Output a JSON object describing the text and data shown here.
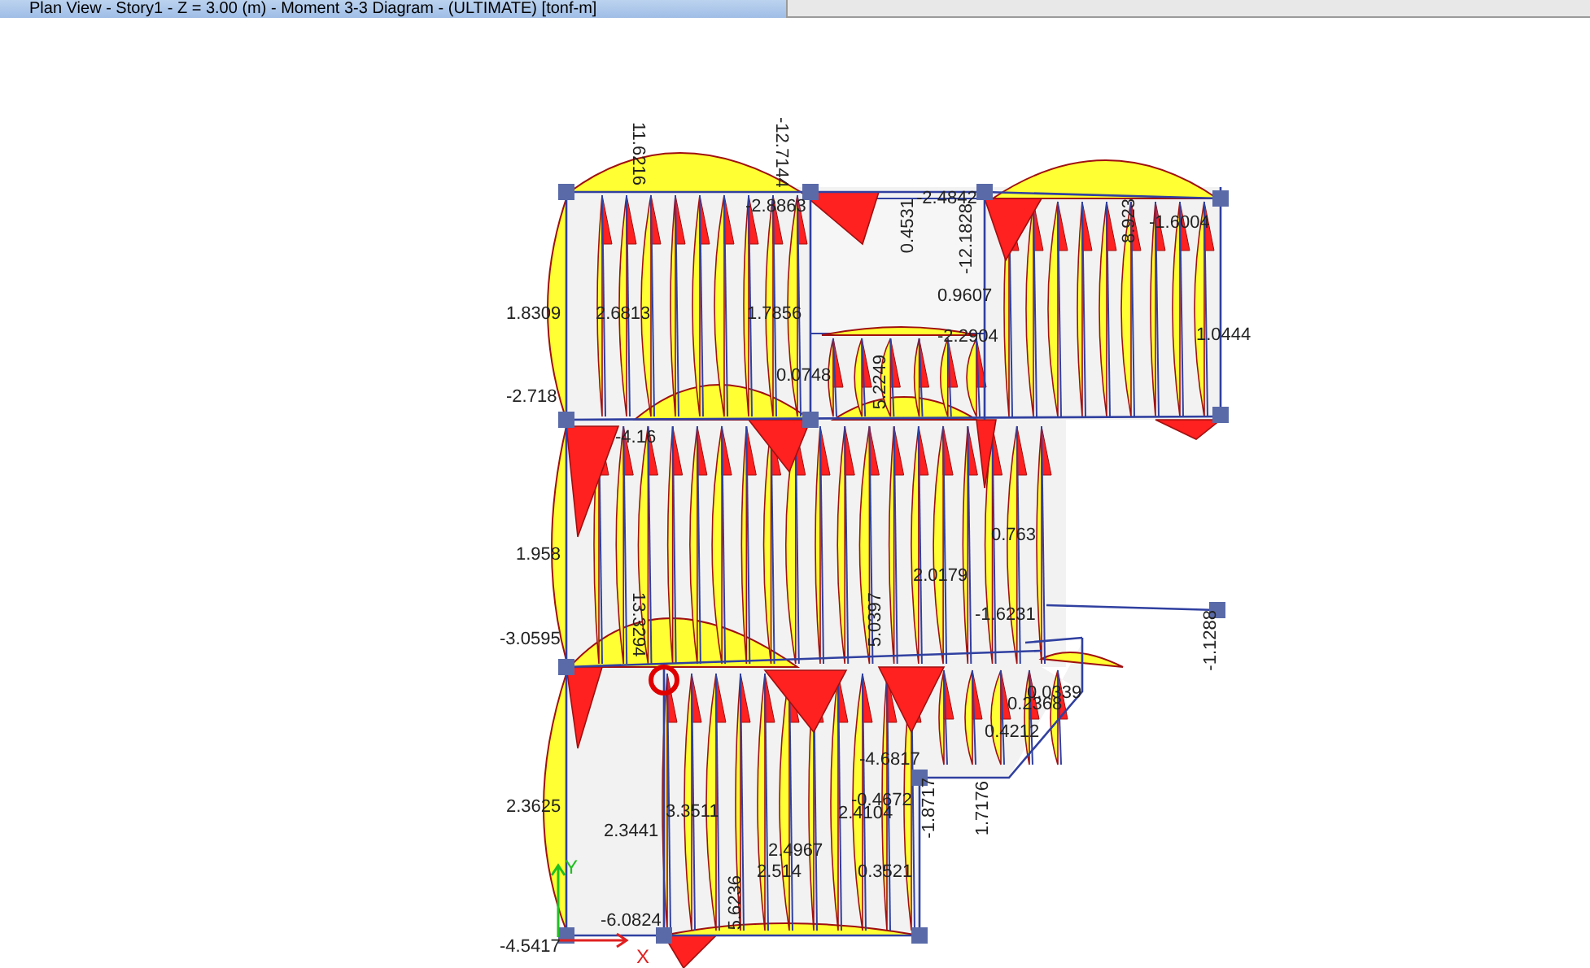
{
  "window": {
    "title": "Plan View - Story1 - Z = 3.00 (m) - Moment 3-3 Diagram - (ULTIMATE) [tonf-m]"
  },
  "diagram_labels": [
    {
      "text": "11.6216"
    },
    {
      "text": "-12.7144"
    },
    {
      "text": "-2.4842"
    },
    {
      "text": "-2.8863"
    },
    {
      "text": "0.4531"
    },
    {
      "text": "-12.1828"
    },
    {
      "text": "-1.6004"
    },
    {
      "text": "8.923"
    },
    {
      "text": "0.9607"
    },
    {
      "text": "1.8309"
    },
    {
      "text": "2.6813"
    },
    {
      "text": "1.7856"
    },
    {
      "text": "-2.2904"
    },
    {
      "text": "1.0444"
    },
    {
      "text": "0.0748"
    },
    {
      "text": "5.2249"
    },
    {
      "text": "-2.718"
    },
    {
      "text": "-4.16"
    },
    {
      "text": "0.763"
    },
    {
      "text": "1.958"
    },
    {
      "text": "2.0179"
    },
    {
      "text": "5.0397"
    },
    {
      "text": "13.3294"
    },
    {
      "text": "-1.6231"
    },
    {
      "text": "-3.0595"
    },
    {
      "text": "-1.1288"
    },
    {
      "text": "0.0339"
    },
    {
      "text": "0.2368"
    },
    {
      "text": "0.4212"
    },
    {
      "text": "-4.6817"
    },
    {
      "text": "-0.4672"
    },
    {
      "text": "2.4104"
    },
    {
      "text": "-1.8717"
    },
    {
      "text": "1.7176"
    },
    {
      "text": "2.3625"
    },
    {
      "text": "3.3511"
    },
    {
      "text": "2.3441"
    },
    {
      "text": "2.4967"
    },
    {
      "text": "2.514"
    },
    {
      "text": "0.3521"
    },
    {
      "text": "5.6236"
    },
    {
      "text": "-6.0824"
    },
    {
      "text": "-4.5417"
    }
  ],
  "axis_labels": [
    {
      "text": "Y"
    },
    {
      "text": "X"
    }
  ]
}
